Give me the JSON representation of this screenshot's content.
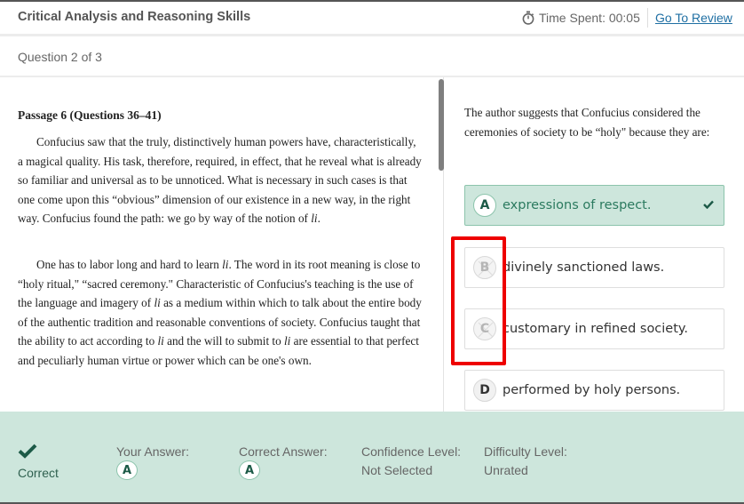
{
  "header": {
    "title": "Critical Analysis and Reasoning Skills",
    "timer_label": "Time Spent: 00:05",
    "timer_icon": "stopwatch-icon",
    "review_link": "Go To Review"
  },
  "question_nav": {
    "counter": "Question 2 of 3"
  },
  "passage": {
    "title": "Passage 6 (Questions 36–41)",
    "paragraphs": [
      {
        "before_italic": "Confucius saw that the truly, distinctively human powers have, characteristically, a magical quality. His task, therefore, required, in effect, that he reveal what is already so familiar and universal as to be unnoticed. What is necessary in such cases is that one come upon this “obvious” dimension of our existence in a new way, in the right way. Confucius found the path: we go by way of the notion of ",
        "italic": "li",
        "after_italic": "."
      },
      {
        "s1": "One has to labor long and hard to learn ",
        "i1": "li",
        "s2": ". The word in its root meaning is close to “holy ritual,\" “sacred ceremony.\" Characteristic of Confucius's teaching is the use of the language and imagery of ",
        "i2": "li",
        "s3": " as a medium within which to talk about the entire body of the authentic tradition and reasonable conventions of society. Confucius taught that the ability to act according to ",
        "i3": "li",
        "s4": " and the will to submit to ",
        "i4": "li",
        "s5": " are essential to that perfect and peculiarly human virtue or power which can be one's own."
      }
    ]
  },
  "question": {
    "stem": "The author suggests that Confucius considered the ceremonies of society to be “holy\" because they are:",
    "options": [
      {
        "letter": "A",
        "text": "expressions of respect.",
        "state": "correct-selected"
      },
      {
        "letter": "B",
        "text": "divinely sanctioned laws.",
        "state": "struck-out"
      },
      {
        "letter": "C",
        "text": "customary in refined society.",
        "state": "struck-out"
      },
      {
        "letter": "D",
        "text": "performed by holy persons.",
        "state": "normal"
      }
    ]
  },
  "result": {
    "status": "Correct",
    "your_answer_label": "Your Answer:",
    "your_answer": "A",
    "correct_answer_label": "Correct Answer:",
    "correct_answer": "A",
    "confidence_label": "Confidence Level:",
    "confidence_value": "Not Selected",
    "difficulty_label": "Difficulty Level:",
    "difficulty_value": "Unrated"
  },
  "colors": {
    "correct_bg": "#cde6dc",
    "correct_border": "#8cc4ac",
    "correct_text": "#2b7a5f",
    "check_dark": "#1c5a47",
    "link": "#1f6fa3",
    "highlight_annotation": "#ee0000"
  }
}
